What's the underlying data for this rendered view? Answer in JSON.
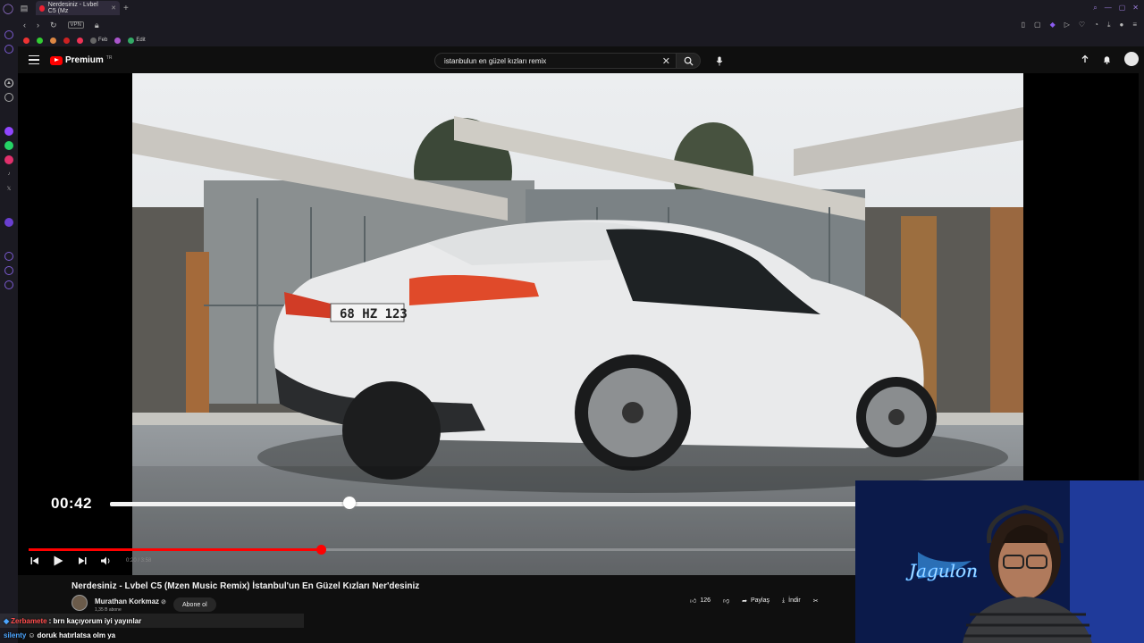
{
  "browser": {
    "tab_title": "Nerdesiniz - Lvbel C5 (Mz",
    "vpn_label": "VPN",
    "bookmarks": [
      {
        "label": "",
        "color": "#e33"
      },
      {
        "label": "",
        "color": "#3c3"
      },
      {
        "label": "",
        "color": "#d84"
      },
      {
        "label": "",
        "color": "#c22"
      },
      {
        "label": "",
        "color": "#e35"
      },
      {
        "label": "Feb",
        "color": "#666"
      },
      {
        "label": "",
        "color": "#a5c"
      },
      {
        "label": "Edit",
        "color": "#3a6"
      }
    ]
  },
  "youtube": {
    "brand": "Premium",
    "region": "TR",
    "search_query": "istanbulun en güzel kızları remix"
  },
  "player": {
    "overlay_time": "00:42",
    "overlay_progress": 0.3,
    "progress": 0.35,
    "time_display": "0:20 / 3:58"
  },
  "video": {
    "title": "Nerdesiniz - Lvbel C5 (Mzen Music Remix) İstanbul'un En Güzel Kızları Ner'desiniz",
    "channel": "Murathan Korkmaz",
    "subscribers": "1,35 B abone",
    "subscribe_label": "Abone ol",
    "likes": "126",
    "share_label": "Paylaş",
    "download_label": "İndir"
  },
  "chat": [
    {
      "user": "Zerbamete",
      "message": ": brn kaçıyorum iyi yayınlar"
    },
    {
      "user": "silenty",
      "message": "doruk hatırlatsa olm ya"
    }
  ],
  "colors": {
    "accent": "#ff0000",
    "sidebar_accent": "#7a5ad0"
  }
}
